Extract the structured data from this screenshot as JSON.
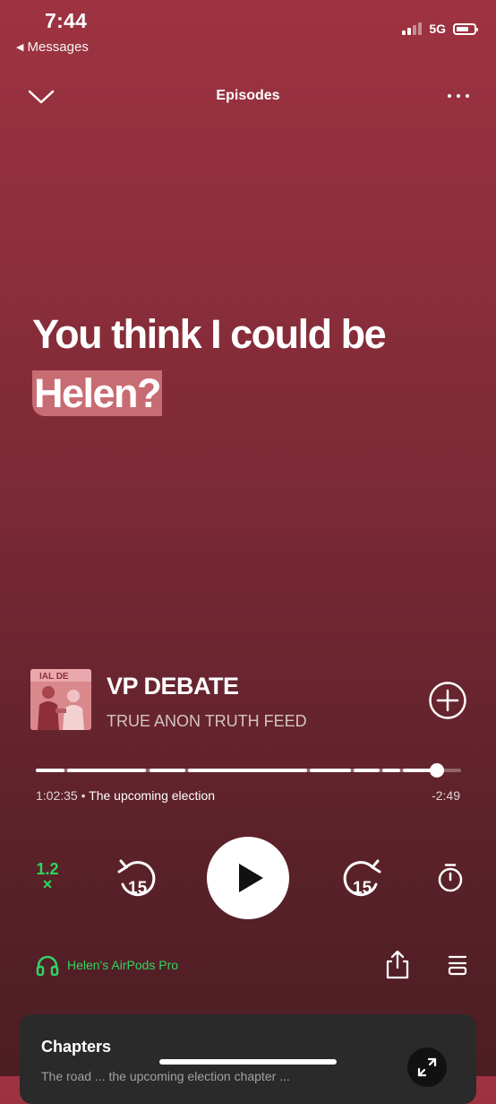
{
  "status": {
    "time": "7:44",
    "back_label": "Messages",
    "network": "5G"
  },
  "nav": {
    "title": "Episodes"
  },
  "quote": {
    "line1": "You think I could be",
    "line2": "Helen?"
  },
  "episode": {
    "title": "VP DEBATE",
    "show": "TRUE ANON TRUTH FEED",
    "art_text": "IAL DE"
  },
  "progress": {
    "current": "1:02:35",
    "chapter": "The upcoming election",
    "remaining": "-2:49",
    "fraction": 0.94
  },
  "controls": {
    "speed_value": "1.2",
    "speed_suffix": "×",
    "skip_back": "15",
    "skip_forward": "15"
  },
  "device": {
    "name": "Helen's AirPods Pro"
  },
  "chapters": {
    "title": "Chapters",
    "subtitle": "The road ... the upcoming election chapter ..."
  },
  "colors": {
    "accent": "#2fd564",
    "background_top": "#9e3341",
    "background_bottom": "#4c1d23",
    "highlight": "#c76c72"
  },
  "icons": [
    "chevron-down-icon",
    "more-icon",
    "add-icon",
    "play-icon",
    "skip-back-15-icon",
    "skip-forward-15-icon",
    "timer-icon",
    "headphones-icon",
    "share-icon",
    "queue-icon",
    "expand-icon"
  ]
}
